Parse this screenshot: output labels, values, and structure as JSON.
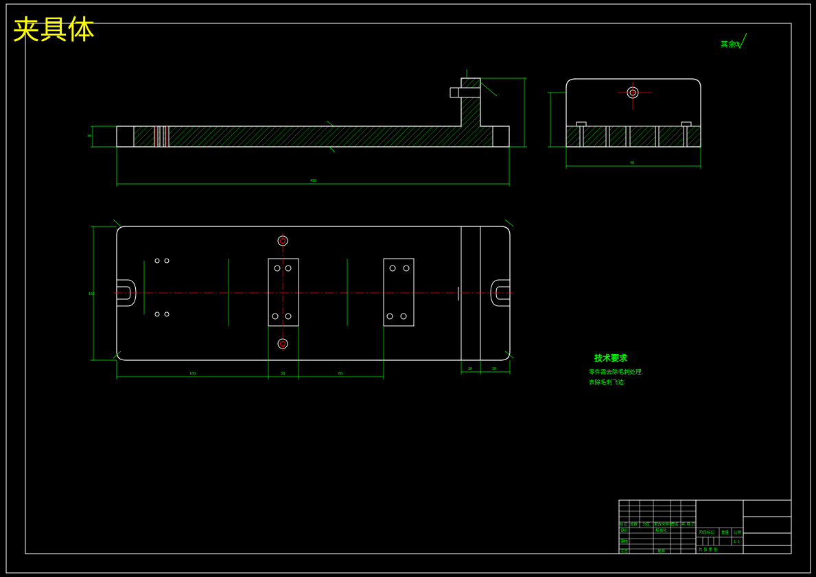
{
  "title": "夹具体",
  "surface_note": "其余",
  "technical_requirements": {
    "heading": "技术要求",
    "items": [
      "零件需去除毛刺处理.",
      "去除毛刺飞边."
    ]
  },
  "dimensions": {
    "front_length": "410",
    "front_height": "30",
    "side_width": "40",
    "plan_height": "135",
    "plan_bottom_1": "160",
    "plan_bottom_2": "30",
    "plan_bottom_3": "60",
    "plan_right_1": "30",
    "plan_right_2": "30"
  },
  "title_block": {
    "row_labels": [
      "设计",
      "审核",
      "工艺"
    ],
    "header_cells": [
      "标记",
      "处数",
      "分区",
      "更改文件号",
      "签名",
      "年.月.日"
    ],
    "standardization": "标准化",
    "approve": "批准",
    "stage_mark": "阶段标记",
    "weight": "重量",
    "scale_label": "比例",
    "scale": "1:1",
    "sheets": "共    张  第    张"
  },
  "colors": {
    "background": "#000000",
    "outline": "#ffffff",
    "dimension": "#00ff00",
    "centerline": "#ff0000",
    "title": "#ffff00",
    "hatch": "#00aa00"
  }
}
